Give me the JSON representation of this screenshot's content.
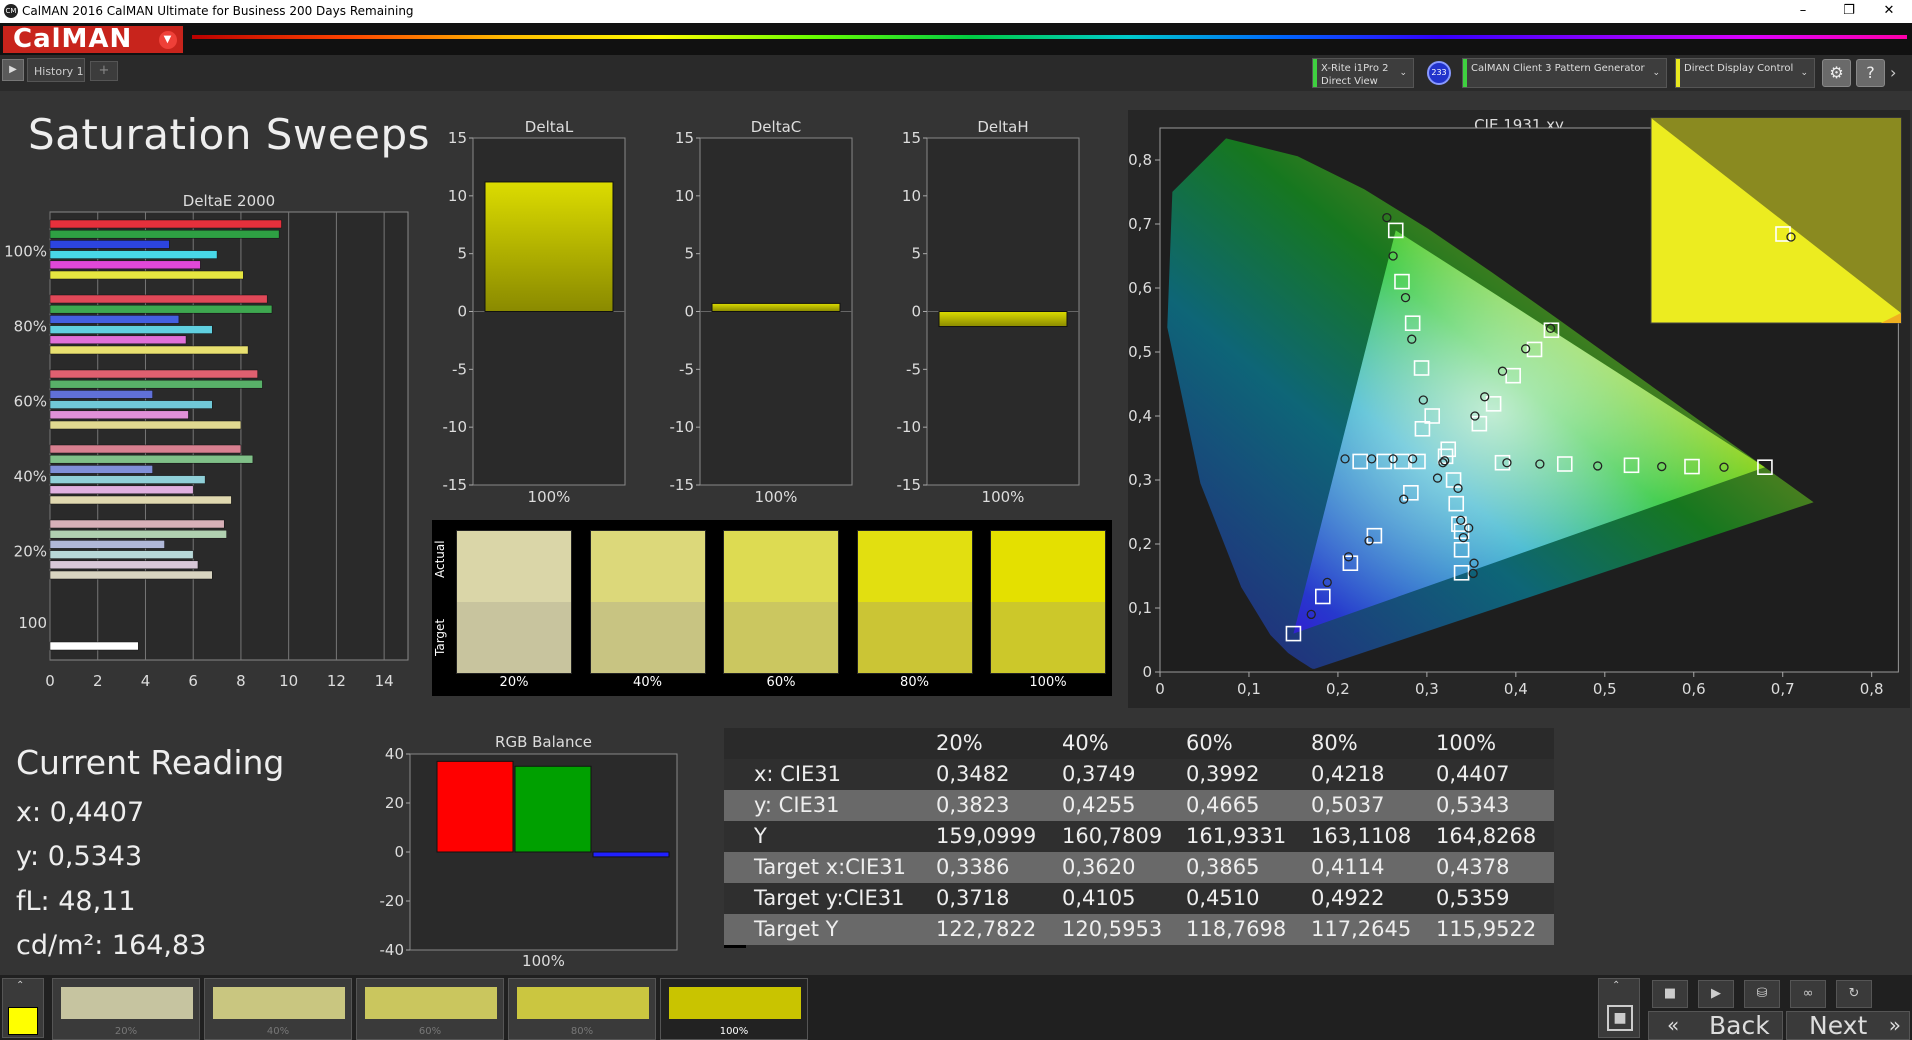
{
  "window": {
    "title": "CalMAN 2016 CalMAN Ultimate for Business 200 Days Remaining",
    "logo": "CalMAN",
    "app_icon": "CM",
    "min": "–",
    "restore": "❐",
    "close": "✕"
  },
  "history": {
    "tab": "History 1",
    "add": "+",
    "play": "▶"
  },
  "devices": {
    "meter": [
      "X-Rite i1Pro 2",
      "Direct View"
    ],
    "meter_badge": "233",
    "generator": "CalMAN Client 3 Pattern Generator",
    "display": "Direct Display Control",
    "chevron": "⌄"
  },
  "toolbar": {
    "settings": "⚙",
    "help": "?",
    "more": "›"
  },
  "page": {
    "title": "Saturation Sweeps"
  },
  "deltaE": {
    "title": "DeltaE 2000",
    "xticks": [
      "0",
      "2",
      "4",
      "6",
      "8",
      "10",
      "12",
      "14"
    ],
    "xmax": 15,
    "groups": [
      {
        "label": "100%",
        "bars": [
          {
            "color": "#e6303c",
            "value": 9.7
          },
          {
            "color": "#2ea043",
            "value": 9.6
          },
          {
            "color": "#2c44e0",
            "value": 5.0
          },
          {
            "color": "#48d8e8",
            "value": 7.0
          },
          {
            "color": "#e048d8",
            "value": 6.3
          },
          {
            "color": "#e6e640",
            "value": 8.1
          }
        ]
      },
      {
        "label": "80%",
        "bars": [
          {
            "color": "#e04858",
            "value": 9.1
          },
          {
            "color": "#3ea850",
            "value": 9.3
          },
          {
            "color": "#4460e0",
            "value": 5.4
          },
          {
            "color": "#60d0e0",
            "value": 6.8
          },
          {
            "color": "#e070d8",
            "value": 5.7
          },
          {
            "color": "#e8e070",
            "value": 8.3
          }
        ]
      },
      {
        "label": "60%",
        "bars": [
          {
            "color": "#e06070",
            "value": 8.7
          },
          {
            "color": "#58b068",
            "value": 8.9
          },
          {
            "color": "#6070d8",
            "value": 4.3
          },
          {
            "color": "#70c8d8",
            "value": 6.8
          },
          {
            "color": "#e090d8",
            "value": 5.8
          },
          {
            "color": "#e0d890",
            "value": 8.0
          }
        ]
      },
      {
        "label": "40%",
        "bars": [
          {
            "color": "#d88090",
            "value": 8.0
          },
          {
            "color": "#80c088",
            "value": 8.5
          },
          {
            "color": "#8090d8",
            "value": 4.3
          },
          {
            "color": "#90d0d8",
            "value": 6.5
          },
          {
            "color": "#e0b0e0",
            "value": 6.0
          },
          {
            "color": "#e0d8b0",
            "value": 7.6
          }
        ]
      },
      {
        "label": "20%",
        "bars": [
          {
            "color": "#d8b0b8",
            "value": 7.3
          },
          {
            "color": "#b0d0b0",
            "value": 7.4
          },
          {
            "color": "#b0b8d8",
            "value": 4.8
          },
          {
            "color": "#b8d8d8",
            "value": 6.0
          },
          {
            "color": "#d8c8d8",
            "value": 6.2
          },
          {
            "color": "#d8d4c0",
            "value": 6.8
          }
        ]
      },
      {
        "label": "100",
        "bars": [
          {
            "color": "#ffffff",
            "value": 3.7
          }
        ]
      }
    ]
  },
  "deltas": {
    "yticks": [
      "15",
      "10",
      "5",
      "0",
      "-5",
      "-10",
      "-15"
    ],
    "xlabel": "100%",
    "panels": [
      {
        "title": "DeltaL",
        "value": 11.2
      },
      {
        "title": "DeltaC",
        "value": 0.7
      },
      {
        "title": "DeltaH",
        "value": -1.3
      }
    ]
  },
  "swatches": {
    "actual": "Actual",
    "target": "Target",
    "items": [
      {
        "label": "20%",
        "actual": "#dad6a8",
        "target": "#c8c49e"
      },
      {
        "label": "40%",
        "actual": "#dcd87a",
        "target": "#c8c482"
      },
      {
        "label": "60%",
        "actual": "#dddb52",
        "target": "#cbc760"
      },
      {
        "label": "80%",
        "actual": "#e2df10",
        "target": "#cbc535"
      },
      {
        "label": "100%",
        "actual": "#e4e000",
        "target": "#ccc82a"
      }
    ]
  },
  "rgb": {
    "title": "RGB Balance",
    "yticks": [
      "40",
      "20",
      "0",
      "-20",
      "-40"
    ],
    "xlabel": "100%",
    "values": {
      "red": 37,
      "green": 35,
      "blue": -2
    }
  },
  "reading": {
    "title": "Current Reading",
    "x": "x: 0,4407",
    "y": "y: 0,5343",
    "fl": "fL: 48,11",
    "cdm2": "cd/m²: 164,83"
  },
  "cie": {
    "title": "CIE 1931 xy",
    "xticks": [
      "0",
      "0,1",
      "0,2",
      "0,3",
      "0,4",
      "0,5",
      "0,6",
      "0,7",
      "0,8"
    ],
    "yticks": [
      "0",
      "0,1",
      "0,2",
      "0,3",
      "0,4",
      "0,5",
      "0,6",
      "0,7",
      "0,8"
    ],
    "targets": [
      [
        0.68,
        0.32
      ],
      [
        0.598,
        0.321
      ],
      [
        0.53,
        0.323
      ],
      [
        0.455,
        0.325
      ],
      [
        0.385,
        0.327
      ],
      [
        0.265,
        0.69
      ],
      [
        0.272,
        0.61
      ],
      [
        0.284,
        0.545
      ],
      [
        0.294,
        0.475
      ],
      [
        0.306,
        0.4
      ],
      [
        0.15,
        0.06
      ],
      [
        0.183,
        0.118
      ],
      [
        0.214,
        0.17
      ],
      [
        0.241,
        0.213
      ],
      [
        0.282,
        0.28
      ],
      [
        0.225,
        0.329
      ],
      [
        0.252,
        0.329
      ],
      [
        0.272,
        0.329
      ],
      [
        0.29,
        0.329
      ],
      [
        0.321,
        0.337
      ],
      [
        0.295,
        0.38
      ],
      [
        0.324,
        0.348
      ],
      [
        0.33,
        0.3
      ],
      [
        0.333,
        0.263
      ],
      [
        0.336,
        0.231
      ],
      [
        0.339,
        0.191
      ],
      [
        0.339,
        0.155
      ],
      [
        0.339,
        0.22
      ],
      [
        0.359,
        0.388
      ],
      [
        0.375,
        0.419
      ],
      [
        0.397,
        0.463
      ],
      [
        0.421,
        0.504
      ],
      [
        0.44,
        0.534
      ]
    ],
    "measured": [
      [
        0.634,
        0.32
      ],
      [
        0.564,
        0.321
      ],
      [
        0.492,
        0.322
      ],
      [
        0.427,
        0.325
      ],
      [
        0.39,
        0.327
      ],
      [
        0.255,
        0.71
      ],
      [
        0.262,
        0.65
      ],
      [
        0.276,
        0.585
      ],
      [
        0.283,
        0.52
      ],
      [
        0.296,
        0.425
      ],
      [
        0.17,
        0.09
      ],
      [
        0.188,
        0.14
      ],
      [
        0.212,
        0.18
      ],
      [
        0.235,
        0.205
      ],
      [
        0.274,
        0.27
      ],
      [
        0.208,
        0.333
      ],
      [
        0.238,
        0.333
      ],
      [
        0.262,
        0.333
      ],
      [
        0.284,
        0.333
      ],
      [
        0.318,
        0.327
      ],
      [
        0.312,
        0.303
      ],
      [
        0.32,
        0.33
      ],
      [
        0.335,
        0.287
      ],
      [
        0.338,
        0.237
      ],
      [
        0.341,
        0.21
      ],
      [
        0.353,
        0.17
      ],
      [
        0.352,
        0.154
      ],
      [
        0.347,
        0.225
      ],
      [
        0.354,
        0.4
      ],
      [
        0.365,
        0.43
      ],
      [
        0.385,
        0.47
      ],
      [
        0.411,
        0.505
      ],
      [
        0.439,
        0.537
      ]
    ],
    "inset_target": [
      0.4378,
      0.5359
    ],
    "inset_measured": [
      0.4407,
      0.5343
    ]
  },
  "table": {
    "columns": [
      "20%",
      "40%",
      "60%",
      "80%",
      "100%"
    ],
    "rows": [
      {
        "label": "x: CIE31",
        "cells": [
          "0,3482",
          "0,3749",
          "0,3992",
          "0,4218",
          "0,4407"
        ]
      },
      {
        "label": "y: CIE31",
        "cells": [
          "0,3823",
          "0,4255",
          "0,4665",
          "0,5037",
          "0,5343"
        ]
      },
      {
        "label": "Y",
        "cells": [
          "159,0999",
          "160,7809",
          "161,9331",
          "163,1108",
          "164,8268"
        ]
      },
      {
        "label": "Target x:CIE31",
        "cells": [
          "0,3386",
          "0,3620",
          "0,3865",
          "0,4114",
          "0,4378"
        ]
      },
      {
        "label": "Target y:CIE31",
        "cells": [
          "0,3718",
          "0,4105",
          "0,4510",
          "0,4922",
          "0,5359"
        ]
      },
      {
        "label": "Target Y",
        "cells": [
          "122,7822",
          "120,5953",
          "118,7698",
          "117,2645",
          "115,9522"
        ]
      }
    ]
  },
  "bottom": {
    "current_color": "#ffff00",
    "swatches": [
      {
        "label": "20%",
        "color": "#c6c4a0"
      },
      {
        "label": "40%",
        "color": "#c9c680"
      },
      {
        "label": "60%",
        "color": "#cac65e"
      },
      {
        "label": "80%",
        "color": "#cbc640"
      },
      {
        "label": "100%",
        "color": "#c9c400"
      }
    ],
    "back": "Back",
    "next": "Next",
    "stop": "■",
    "play": "▶",
    "save": "⛁",
    "loop": "∞",
    "refresh": "↻",
    "up": "⌃"
  }
}
